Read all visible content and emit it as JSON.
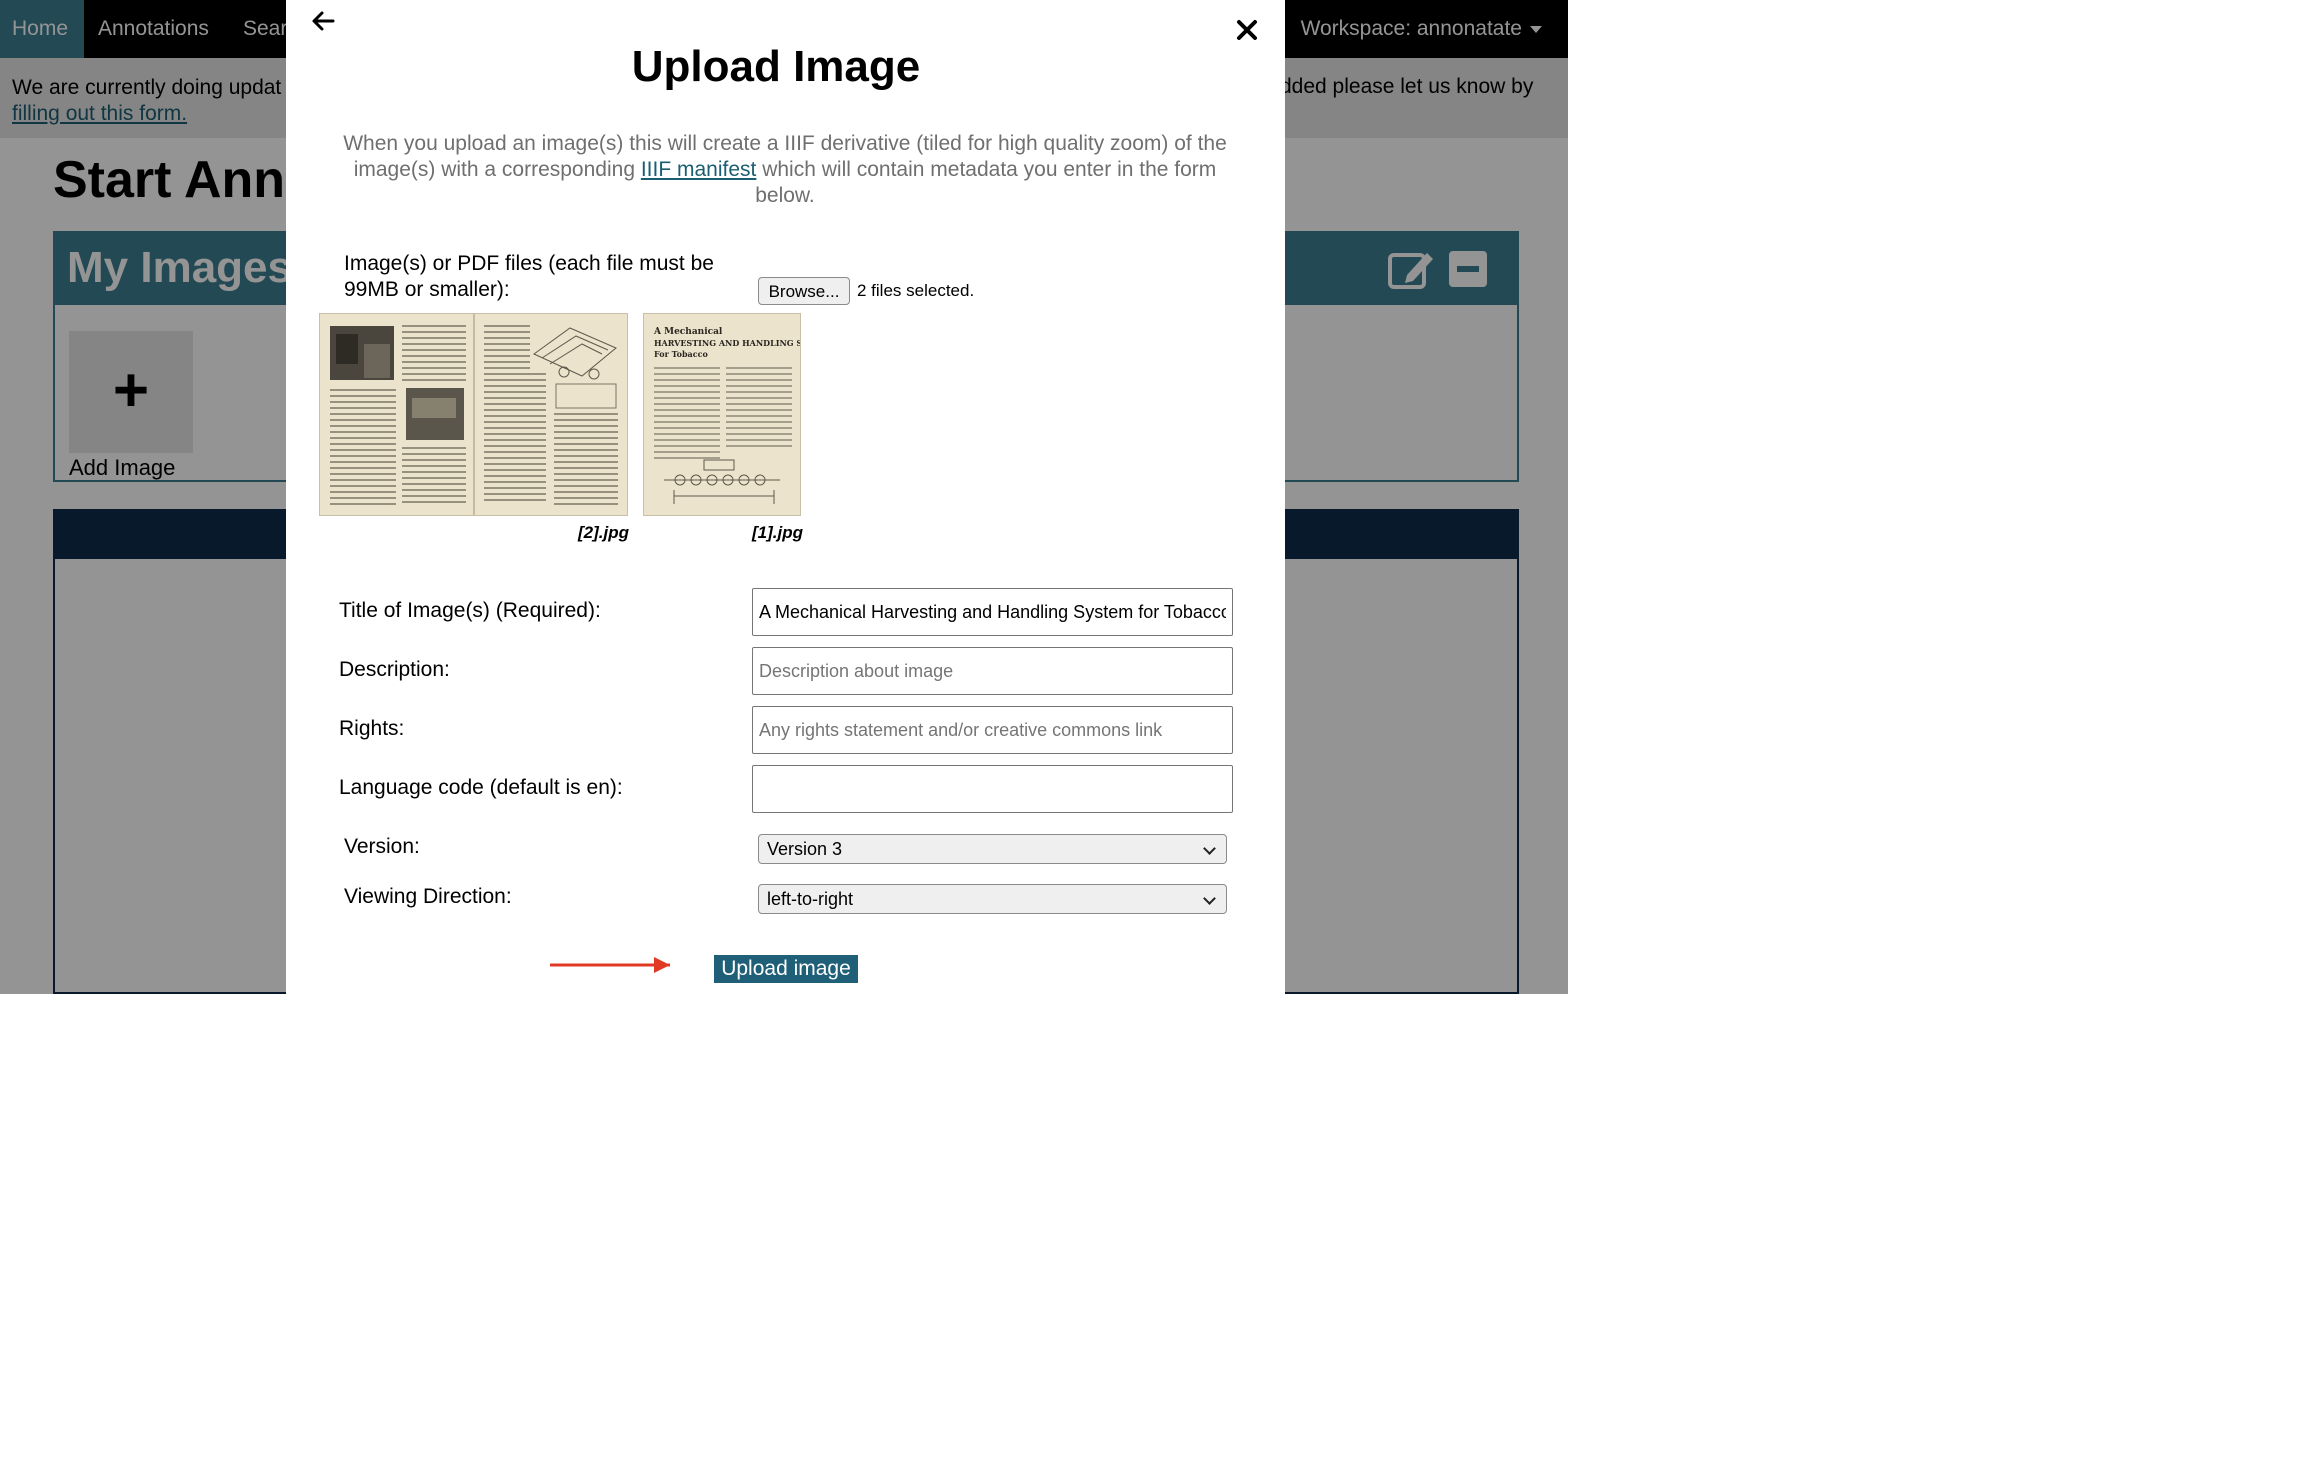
{
  "nav": {
    "home": "Home",
    "annotations": "Annotations",
    "search": "Sear",
    "workspace": "Workspace: annonatate"
  },
  "banner": {
    "text": "We are currently doing updat",
    "link": "filling out this form.",
    "right_text": "dded please let us know by"
  },
  "page": {
    "title": "Start Ann",
    "images_title": "My Images",
    "add_image_label": "Add Image",
    "add_plus": "+"
  },
  "modal": {
    "title": "Upload Image",
    "desc_before": "When you upload an image(s) this will create a IIIF derivative (tiled for high quality zoom) of the image(s) with a corresponding ",
    "desc_link": "IIIF manifest",
    "desc_after": " which will contain metadata you enter in the form below.",
    "files_label": "Image(s) or PDF files (each file must be 99MB or smaller):",
    "browse_label": "Browse...",
    "files_count": "2 files selected.",
    "thumbnails": [
      {
        "name": "[2].jpg"
      },
      {
        "name": "[1].jpg"
      }
    ],
    "thumb1_heading": "A Mechanical HARVESTING AND HANDLING SYSTEM For Tobacco",
    "fields": {
      "title_label": "Title of Image(s) (Required):",
      "title_value": "A Mechanical Harvesting and Handling System for Tobacco",
      "description_label": "Description:",
      "description_placeholder": "Description about image",
      "rights_label": "Rights:",
      "rights_placeholder": "Any rights statement and/or creative commons link",
      "language_label": "Language code (default is en):",
      "language_value": "",
      "version_label": "Version:",
      "version_value": "Version 3",
      "direction_label": "Viewing Direction:",
      "direction_value": "left-to-right"
    },
    "upload_label": "Upload image"
  },
  "colors": {
    "teal": "#3b7f91",
    "navy": "#0e2b4a",
    "upload_button": "#1f5f78",
    "annotation_arrow": "#e03a25"
  }
}
